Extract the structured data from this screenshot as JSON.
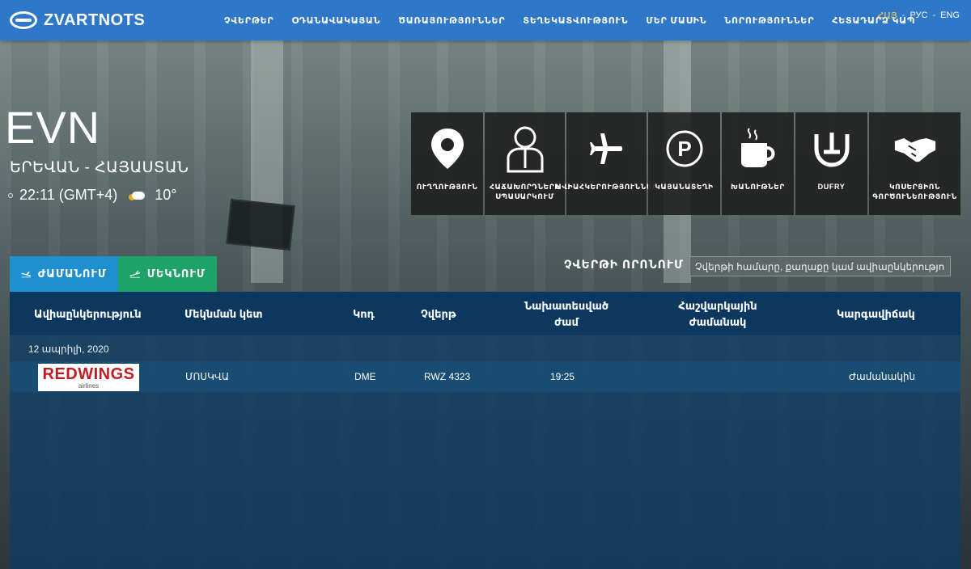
{
  "brand": {
    "name": "ZVARTNOTS"
  },
  "nav": {
    "items": [
      "ՉՎԵՐԹԵՐ",
      "ՕԴԱՆԱՎԱԿԱՅԱՆ",
      "ԾԱՌԱՅՈՒԹՅՈՒՆՆԵՐ",
      "ՏԵՂԵԿԱՏՎՈՒԹՅՈՒՆ",
      "ՄԵՐ ՄԱՍԻՆ",
      "ՆՈՐՈՒԹՅՈՒՆՆԵՐ",
      "ՀԵՏԱԴԱՐՁ ԿԱՊ"
    ],
    "languages": [
      "ՀԱՅ",
      "РУС",
      "ENG"
    ],
    "active_language": "ՀԱՅ",
    "lang_separator": "-"
  },
  "location": {
    "iata": "EVN",
    "city": "ԵՐԵՎԱՆ - ՀԱՅԱՍՏԱՆ",
    "time": "22:11 (GMT+4)",
    "temperature": "10°"
  },
  "services": [
    {
      "label": "ՈՒՂՂՈՒԹՅՈՒՆ",
      "icon": "location-pin-icon"
    },
    {
      "label": "ՀԱՃԱԽՈՐԴՆԵՐԻ ՍՊԱՍԱՐԿՈՒՄ",
      "icon": "person-icon"
    },
    {
      "label": "ԱՎԻԱՀԿԵՐՈՒԹՅՈՒՆՆԵՐ",
      "icon": "airplane-icon"
    },
    {
      "label": "ԿԱՅԱՆԱՏԵՂԻ",
      "icon": "parking-icon"
    },
    {
      "label": "ԽԱՆՈՒԹՆԵՐ",
      "icon": "coffee-cup-icon"
    },
    {
      "label": "DUFRY",
      "icon": "dufry-icon"
    },
    {
      "label": "ԿՈՍԵՐՑԻՈՆ ԳՈՐԾՈՒՆԵՈՒԹՅՈՒՆ",
      "icon": "handshake-icon"
    }
  ],
  "tabs": {
    "arrivals": "ԺԱՄԱՆՈՒՄ",
    "departures": "ՄԵԿՆՈՒՄ"
  },
  "search": {
    "label": "ՉՎԵՐԹԻ ՈՐՈՆՈՒՄ",
    "placeholder": "Չվերթի համարը, քաղաքը կամ ավիաընկերությունը"
  },
  "table": {
    "headers": {
      "airline": "Ավիաընկերություն",
      "origin": "Մեկնման կետ",
      "code": "Կոդ",
      "flight": "Չվերթ",
      "scheduled_1": "Նախատեսված",
      "scheduled_2": "ժամ",
      "estimated_1": "Հաշվարկային",
      "estimated_2": "ժամանակ",
      "status": "Կարգավիճակ"
    },
    "date": "12 ապրիլի, 2020",
    "rows": [
      {
        "airline_logo_text": "REDWINGS",
        "airline_logo_sub": "airlines",
        "origin": "ՄՈՍԿՎԱ",
        "code": "DME",
        "flight": "RWZ 4323",
        "scheduled": "19:25",
        "estimated": "",
        "status": "Ժամանակին"
      }
    ]
  },
  "colors": {
    "topbar": "#2f78c9",
    "arrivals_tab": "#1f8fd0",
    "departures_tab": "#1ea267",
    "active_language": "#ffd84a",
    "airline_logo_red": "#c11c22"
  }
}
